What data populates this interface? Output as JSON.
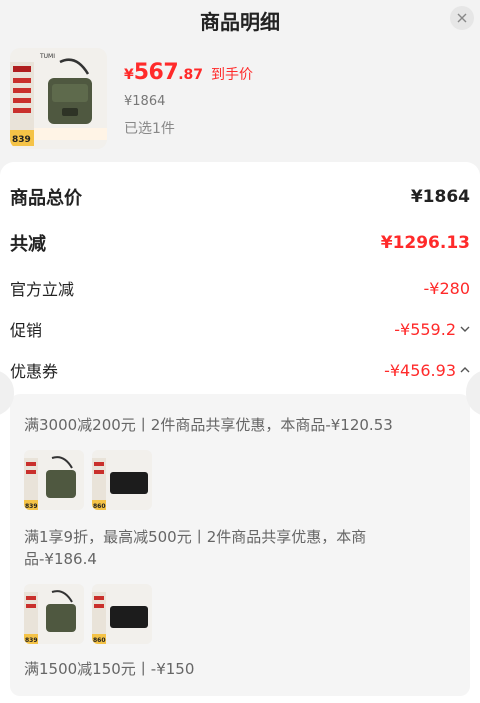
{
  "header": {
    "title": "商品明细",
    "close_icon": "close-icon"
  },
  "product": {
    "currency": "¥",
    "price_int": "567",
    "price_dec": ".87",
    "price_tag": "到手价",
    "original_price": "¥1864",
    "selected": "已选1件",
    "thumb_brand": "TUMI",
    "thumb_badge": "839"
  },
  "summary": {
    "total_label": "商品总价",
    "total_value": "¥1864",
    "discount_label": "共减",
    "discount_value": "¥1296.13",
    "rows": [
      {
        "label": "官方立减",
        "value": "-¥280"
      },
      {
        "label": "促销",
        "value": "-¥559.2"
      },
      {
        "label": "优惠券",
        "value": "-¥456.93"
      }
    ]
  },
  "coupons": [
    {
      "text": "满3000减200元丨2件商品共享优惠，本商品-¥120.53"
    },
    {
      "text_line1": "满1享9折，最高减500元丨2件商品共享优惠，本商",
      "text_line2": "品-¥186.4"
    },
    {
      "text": "满1500减150元丨-¥150"
    }
  ],
  "thumb_badges": {
    "bag": "839",
    "wallet": "860"
  },
  "colors": {
    "accent": "#ff2a2a",
    "panel": "#ffffff",
    "bg": "#f3f3f3"
  }
}
